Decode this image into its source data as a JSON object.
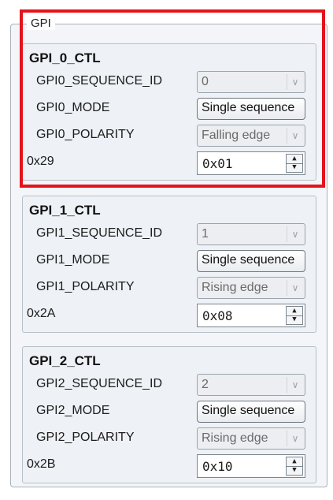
{
  "group": {
    "title": "GPI"
  },
  "panels": [
    {
      "title": "GPI_0_CTL",
      "sequence_label": "GPI0_SEQUENCE_ID",
      "sequence_value": "0",
      "mode_label": "GPI0_MODE",
      "mode_value": "Single sequence",
      "polarity_label": "GPI0_POLARITY",
      "polarity_value": "Falling edge",
      "register_label": "0x29",
      "register_value": "0x01"
    },
    {
      "title": "GPI_1_CTL",
      "sequence_label": "GPI1_SEQUENCE_ID",
      "sequence_value": "1",
      "mode_label": "GPI1_MODE",
      "mode_value": "Single sequence",
      "polarity_label": "GPI1_POLARITY",
      "polarity_value": "Rising edge",
      "register_label": "0x2A",
      "register_value": "0x08"
    },
    {
      "title": "GPI_2_CTL",
      "sequence_label": "GPI2_SEQUENCE_ID",
      "sequence_value": "2",
      "mode_label": "GPI2_MODE",
      "mode_value": "Single sequence",
      "polarity_label": "GPI2_POLARITY",
      "polarity_value": "Rising edge",
      "register_label": "0x2B",
      "register_value": "0x10"
    }
  ],
  "icons": {
    "combo_arrow": "chevron-down-icon",
    "spin_up": "spin-up-icon",
    "spin_down": "spin-down-icon"
  },
  "colors": {
    "highlight": "#e3141b",
    "frame": "#a9b3bd",
    "panel_bg": "#eef1f5"
  }
}
